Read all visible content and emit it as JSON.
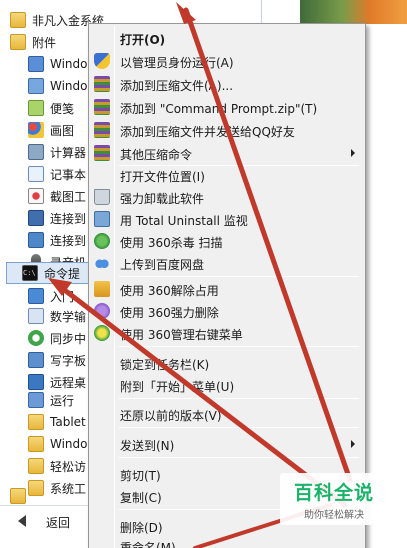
{
  "start_menu": {
    "items": [
      {
        "label": "非凡入金系统",
        "icon": "folder-icon"
      },
      {
        "label": "附件",
        "icon": "folder-icon"
      },
      {
        "label": "Windo",
        "icon": "window-icon"
      },
      {
        "label": "Windo",
        "icon": "window-icon"
      },
      {
        "label": "便笺",
        "icon": "note-icon"
      },
      {
        "label": "画图",
        "icon": "paint-icon"
      },
      {
        "label": "计算器",
        "icon": "calculator-icon"
      },
      {
        "label": "记事本",
        "icon": "notepad-icon"
      },
      {
        "label": "截图工",
        "icon": "scissors-icon"
      },
      {
        "label": "连接到",
        "icon": "projector-icon"
      },
      {
        "label": "连接到",
        "icon": "remote-icon"
      },
      {
        "label": "录音机",
        "icon": "microphone-icon"
      },
      {
        "label": "命令提",
        "icon": "cmd-icon"
      },
      {
        "label": "入门",
        "icon": "getting-started-icon"
      },
      {
        "label": "数学输",
        "icon": "math-icon"
      },
      {
        "label": "同步中",
        "icon": "sync-icon"
      },
      {
        "label": "写字板",
        "icon": "wordpad-icon"
      },
      {
        "label": "远程桌",
        "icon": "remote-desktop-icon"
      },
      {
        "label": "运行",
        "icon": "run-icon"
      },
      {
        "label": "Tablet",
        "icon": "folder-icon"
      },
      {
        "label": "Windo",
        "icon": "folder-icon"
      },
      {
        "label": "轻松访",
        "icon": "folder-icon"
      },
      {
        "label": "系统工",
        "icon": "folder-icon"
      },
      {
        "label": "",
        "icon": "folder-icon"
      }
    ],
    "back_label": "返回"
  },
  "context_menu": {
    "items": [
      {
        "label": "打开(O)",
        "icon": "",
        "bold": true
      },
      {
        "label": "以管理员身份运行(A)",
        "icon": "shield-icon"
      },
      {
        "label": "添加到压缩文件(A)...",
        "icon": "rar-icon"
      },
      {
        "label": "添加到 \"Command Prompt.zip\"(T)",
        "icon": "rar-icon"
      },
      {
        "label": "添加到压缩文件并发送给QQ好友",
        "icon": "rar-icon"
      },
      {
        "label": "其他压缩命令",
        "icon": "rar-icon",
        "submenu": true
      },
      {
        "label": "打开文件位置(I)",
        "icon": ""
      },
      {
        "label": "强力卸载此软件",
        "icon": "trash-icon"
      },
      {
        "label": "用 Total Uninstall 监视",
        "icon": "uninstall-icon"
      },
      {
        "label": "使用 360杀毒 扫描",
        "icon": "360-antivirus-icon"
      },
      {
        "label": "上传到百度网盘",
        "icon": "baidu-cloud-icon"
      },
      {
        "label": "使用 360解除占用",
        "icon": "unlock-icon"
      },
      {
        "label": "使用 360强力删除",
        "icon": "360-delete-icon"
      },
      {
        "label": "使用 360管理右键菜单",
        "icon": "360-manage-icon"
      },
      {
        "label": "锁定到任务栏(K)",
        "icon": ""
      },
      {
        "label": "附到「开始」菜单(U)",
        "icon": ""
      },
      {
        "label": "还原以前的版本(V)",
        "icon": ""
      },
      {
        "label": "发送到(N)",
        "icon": "",
        "submenu": true
      },
      {
        "label": "剪切(T)",
        "icon": ""
      },
      {
        "label": "复制(C)",
        "icon": ""
      },
      {
        "label": "删除(D)",
        "icon": ""
      },
      {
        "label": "重命名(M)",
        "icon": ""
      }
    ]
  },
  "watermark": {
    "main": "百科全说",
    "sub": "助你轻松解决"
  },
  "colors": {
    "arrow": "#c0392b",
    "menu_bg": "#f0f0f0",
    "highlight": "#dce8f6",
    "watermark_green": "#1bb36a"
  }
}
